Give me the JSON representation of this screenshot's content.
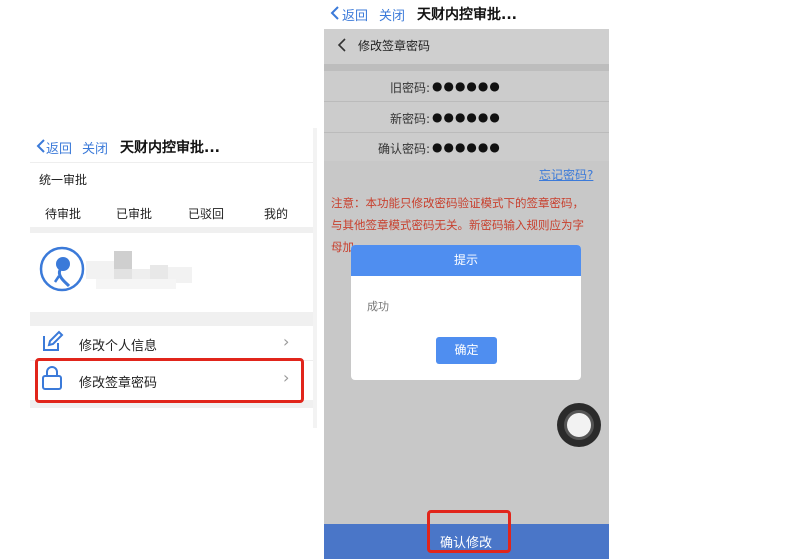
{
  "left": {
    "nav": {
      "back": "返回",
      "close": "关闭",
      "title": "天财内控审批..."
    },
    "section_title": "统一审批",
    "tabs": [
      {
        "label": "待审批"
      },
      {
        "label": "已审批"
      },
      {
        "label": "已驳回"
      },
      {
        "label": "我的"
      }
    ],
    "menu": [
      {
        "label": "修改个人信息",
        "icon": "edit-icon"
      },
      {
        "label": "修改签章密码",
        "icon": "lock-icon"
      }
    ]
  },
  "right": {
    "nav": {
      "back": "返回",
      "close": "关闭",
      "title": "天财内控审批..."
    },
    "page_title": "修改签章密码",
    "fields": [
      {
        "label": "旧密码:",
        "value": "●●●●●●"
      },
      {
        "label": "新密码:",
        "value": "●●●●●●"
      },
      {
        "label": "确认密码:",
        "value": "●●●●●●"
      }
    ],
    "forgot_link": "忘记密码?",
    "notice_lines": [
      "注意：本功能只修改密码验证模式下的签章密码，",
      "与其他签章模式密码无关。新密码输入规则应为字",
      "母加"
    ],
    "dialog": {
      "title": "提示",
      "message": "成功",
      "ok": "确定"
    },
    "confirm_button": "确认修改"
  },
  "colors": {
    "accent_blue": "#4f8ef0",
    "link_blue": "#3b7ad9",
    "highlight_red": "#e1251b",
    "notice_red": "#c8402e"
  }
}
